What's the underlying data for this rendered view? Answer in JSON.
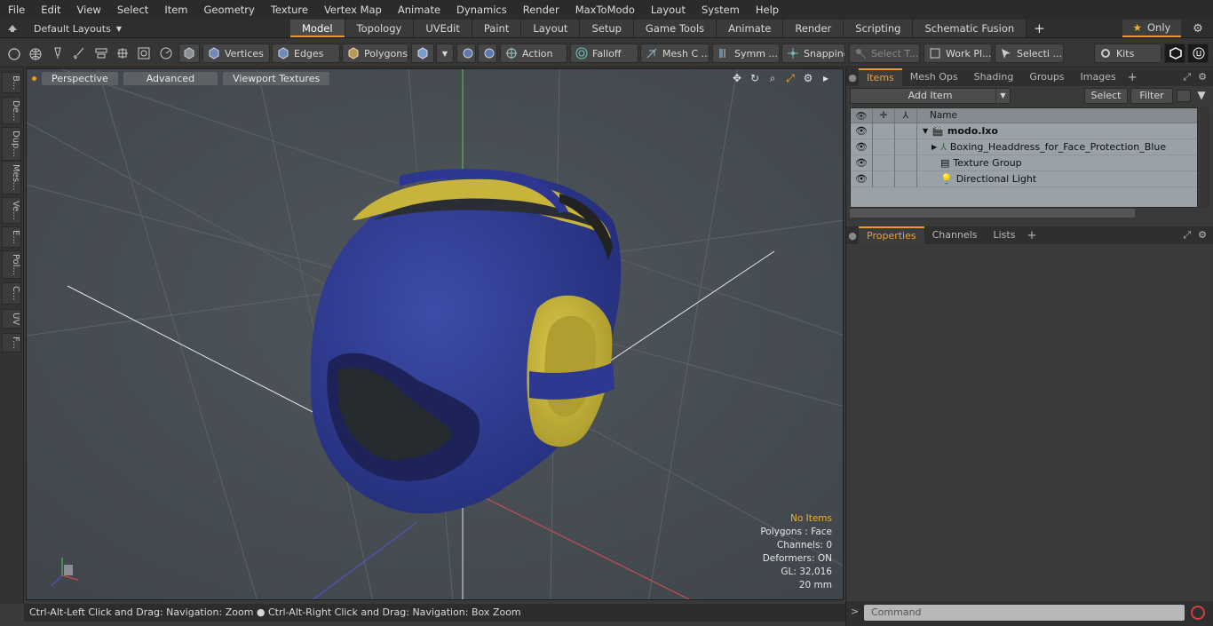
{
  "menu": [
    "File",
    "Edit",
    "View",
    "Select",
    "Item",
    "Geometry",
    "Texture",
    "Vertex Map",
    "Animate",
    "Dynamics",
    "Render",
    "MaxToModo",
    "Layout",
    "System",
    "Help"
  ],
  "layout_dropdown": "Default Layouts",
  "tabs": [
    {
      "label": "Model",
      "active": true
    },
    {
      "label": "Topology",
      "active": false
    },
    {
      "label": "UVEdit",
      "active": false
    },
    {
      "label": "Paint",
      "active": false
    },
    {
      "label": "Layout",
      "active": false
    },
    {
      "label": "Setup",
      "active": false
    },
    {
      "label": "Game Tools",
      "active": false
    },
    {
      "label": "Animate",
      "active": false
    },
    {
      "label": "Render",
      "active": false
    },
    {
      "label": "Scripting",
      "active": false
    },
    {
      "label": "Schematic Fusion",
      "active": false
    }
  ],
  "tab_add": "+",
  "only_label": "Only",
  "toolbar": {
    "vertices": "Vertices",
    "edges": "Edges",
    "polygons": "Polygons",
    "action": "Action",
    "falloff": "Falloff",
    "mesh": "Mesh C ...",
    "symm": "Symm ...",
    "snapping": "Snapping",
    "select_t": "Select T...",
    "work_pl": "Work Pl...",
    "selecti": "Selecti ...",
    "kits": "Kits"
  },
  "left_strip": [
    "B...",
    "De...",
    "Dup...",
    "Mes...",
    "Ve...",
    "E...",
    "Pol...",
    "C...",
    "UV",
    "F..."
  ],
  "viewport": {
    "pills": [
      "Perspective",
      "Advanced",
      "Viewport Textures"
    ],
    "info": {
      "no_items": "No Items",
      "polygons": "Polygons : Face",
      "channels": "Channels: 0",
      "deformers": "Deformers: ON",
      "gl": "GL: 32,016",
      "scale": "20 mm"
    }
  },
  "status": "Ctrl-Alt-Left Click and Drag: Navigation: Zoom ● Ctrl-Alt-Right Click and Drag: Navigation: Box Zoom",
  "items_panel": {
    "tabs": [
      {
        "label": "Items",
        "active": true
      },
      {
        "label": "Mesh Ops",
        "active": false
      },
      {
        "label": "Shading",
        "active": false
      },
      {
        "label": "Groups",
        "active": false
      },
      {
        "label": "Images",
        "active": false
      }
    ],
    "add_item": "Add Item",
    "select": "Select",
    "filter": "Filter",
    "name_col": "Name",
    "rows": [
      "modo.lxo",
      "Boxing_Headdress_for_Face_Protection_Blue",
      "Texture Group",
      "Directional Light"
    ]
  },
  "props_panel": {
    "tabs": [
      {
        "label": "Properties",
        "active": true
      },
      {
        "label": "Channels",
        "active": false
      },
      {
        "label": "Lists",
        "active": false
      }
    ]
  },
  "command_placeholder": "Command",
  "colors": {
    "accent": "#e89b2a",
    "helmet_blue": "#2e3a92",
    "helmet_yellow": "#c8b43a",
    "viewport_bg": "#4a5056"
  }
}
